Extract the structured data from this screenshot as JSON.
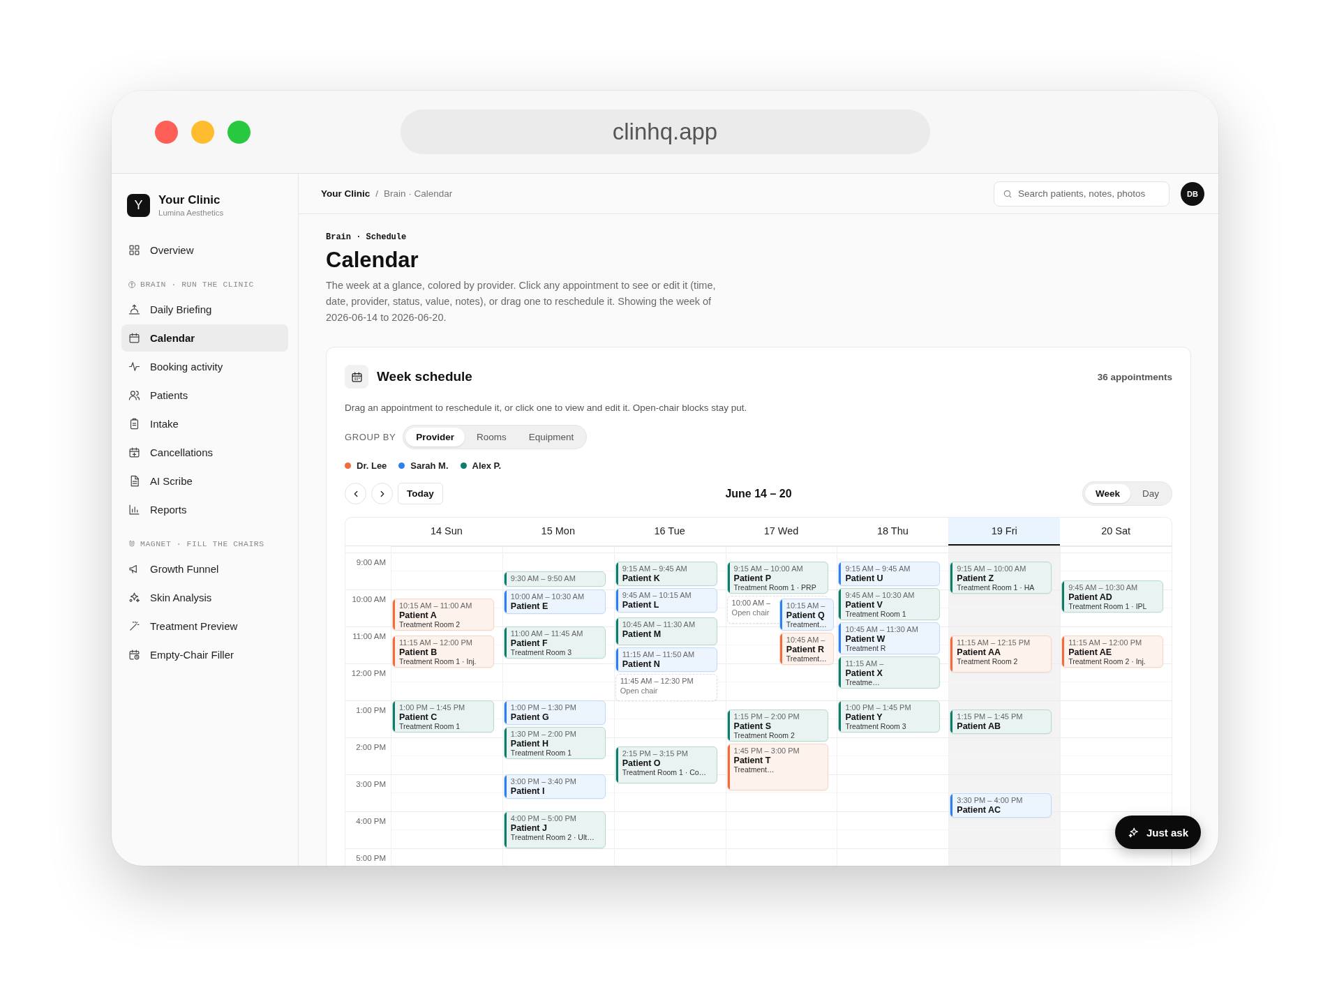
{
  "browser": {
    "url": "clinhq.app"
  },
  "sidebar": {
    "brand": {
      "logo": "Y",
      "name": "Your Clinic",
      "subtitle": "Lumina Aesthetics"
    },
    "nav": [
      {
        "kind": "item",
        "label": "Overview",
        "selected": false
      },
      {
        "kind": "section",
        "label": "BRAIN · RUN THE CLINIC"
      },
      {
        "kind": "item",
        "label": "Daily Briefing",
        "selected": false
      },
      {
        "kind": "item",
        "label": "Calendar",
        "selected": true
      },
      {
        "kind": "item",
        "label": "Booking activity",
        "selected": false
      },
      {
        "kind": "item",
        "label": "Patients",
        "selected": false
      },
      {
        "kind": "item",
        "label": "Intake",
        "selected": false
      },
      {
        "kind": "item",
        "label": "Cancellations",
        "selected": false
      },
      {
        "kind": "item",
        "label": "AI Scribe",
        "selected": false
      },
      {
        "kind": "item",
        "label": "Reports",
        "selected": false
      },
      {
        "kind": "section",
        "label": "MAGNET · FILL THE CHAIRS"
      },
      {
        "kind": "item",
        "label": "Growth Funnel",
        "selected": false
      },
      {
        "kind": "item",
        "label": "Skin Analysis",
        "selected": false
      },
      {
        "kind": "item",
        "label": "Treatment Preview",
        "selected": false
      },
      {
        "kind": "item",
        "label": "Empty-Chair Filler",
        "selected": false
      }
    ]
  },
  "topbar": {
    "breadcrumb": {
      "root": "Your Clinic",
      "separator": "/",
      "current": "Brain · Calendar"
    },
    "search": {
      "placeholder": "Search patients, notes, photos"
    },
    "avatar": "DB"
  },
  "page": {
    "eyebrow": "Brain · Schedule",
    "title": "Calendar",
    "description": "The week at a glance, colored by provider. Click any appointment to see or edit it (time, date, provider, status, value, notes), or drag one to reschedule it. Showing the week of 2026-06-14 to 2026-06-20."
  },
  "schedule": {
    "title": "Week schedule",
    "count": "36 appointments",
    "hint": "Drag an appointment to reschedule it, or click one to view and edit it. Open-chair blocks stay put.",
    "group_by": {
      "label": "GROUP BY",
      "options": [
        {
          "label": "Provider",
          "selected": true
        },
        {
          "label": "Rooms",
          "selected": false
        },
        {
          "label": "Equipment",
          "selected": false
        }
      ]
    },
    "providers": [
      {
        "name": "Dr. Lee",
        "color": "#f26b3a"
      },
      {
        "name": "Sarah M.",
        "color": "#2f80ed"
      },
      {
        "name": "Alex P.",
        "color": "#0e7c6b"
      }
    ],
    "today": "Today",
    "range": "June 14 – 20",
    "views": [
      {
        "label": "Week",
        "selected": true
      },
      {
        "label": "Day",
        "selected": false
      }
    ],
    "hours": [
      "9:00 AM",
      "10:00 AM",
      "11:00 AM",
      "12:00 PM",
      "1:00 PM",
      "2:00 PM",
      "3:00 PM",
      "4:00 PM",
      "5:00 PM"
    ],
    "days": [
      {
        "label": "14 Sun",
        "selected": false,
        "appointments": [
          {
            "kind": "booked",
            "time": "10:15 AM – 11:00 AM",
            "patient": "Patient A",
            "detail": "Treatment Room 2",
            "color": "#f26b3a"
          },
          {
            "kind": "booked",
            "time": "11:15 AM – 12:00 PM",
            "patient": "Patient B",
            "detail": "Treatment Room 1 · Inj.",
            "color": "#f26b3a"
          },
          {
            "kind": "booked",
            "time": "1:00 PM – 1:45 PM",
            "patient": "Patient C",
            "detail": "Treatment Room 1",
            "color": "#0e7c6b"
          }
        ]
      },
      {
        "label": "15 Mon",
        "selected": false,
        "appointments": [
          {
            "kind": "booked",
            "time": "9:30 AM – 9:50 AM",
            "color": "#0e7c6b"
          },
          {
            "kind": "booked",
            "time": "10:00 AM – 10:30 AM",
            "patient": "Patient E",
            "color": "#2f80ed"
          },
          {
            "kind": "booked",
            "time": "11:00 AM – 11:45 AM",
            "patient": "Patient F",
            "detail": "Treatment Room 3",
            "color": "#0e7c6b"
          },
          {
            "kind": "booked",
            "time": "1:00 PM – 1:30 PM",
            "patient": "Patient G",
            "color": "#2f80ed"
          },
          {
            "kind": "booked",
            "time": "1:30 PM – 2:00 PM",
            "patient": "Patient H",
            "detail": "Treatment Room 1",
            "color": "#0e7c6b"
          },
          {
            "kind": "booked",
            "time": "3:00 PM – 3:40 PM",
            "patient": "Patient I",
            "color": "#2f80ed"
          },
          {
            "kind": "booked",
            "time": "4:00 PM – 5:00 PM",
            "patient": "Patient J",
            "detail": "Treatment Room 2 · Ult…",
            "color": "#0e7c6b"
          }
        ]
      },
      {
        "label": "16 Tue",
        "selected": false,
        "appointments": [
          {
            "kind": "booked",
            "time": "9:15 AM – 9:45 AM",
            "patient": "Patient K",
            "color": "#0e7c6b"
          },
          {
            "kind": "booked",
            "time": "9:45 AM – 10:15 AM",
            "patient": "Patient L",
            "color": "#2f80ed"
          },
          {
            "kind": "booked",
            "time": "10:45 AM – 11:30 AM",
            "patient": "Patient M",
            "color": "#0e7c6b"
          },
          {
            "kind": "booked",
            "time": "11:15 AM – 11:50 AM",
            "patient": "Patient N",
            "color": "#2f80ed"
          },
          {
            "kind": "open",
            "time": "11:45 AM – 12:30 PM",
            "label": "Open chair"
          },
          {
            "kind": "booked",
            "time": "2:15 PM – 3:15 PM",
            "patient": "Patient O",
            "detail": "Treatment Room 1 · Co…",
            "color": "#0e7c6b"
          }
        ]
      },
      {
        "label": "17 Wed",
        "selected": false,
        "appointments": [
          {
            "kind": "booked",
            "time": "9:15 AM – 10:00 AM",
            "patient": "Patient P",
            "detail": "Treatment Room 1 · PRP",
            "color": "#0e7c6b"
          },
          {
            "kind": "open",
            "time": "10:00 AM –",
            "label": "Open chair"
          },
          {
            "kind": "booked",
            "time": "10:15 AM –",
            "patient": "Patient Q",
            "detail": "Treatment…",
            "color": "#2f80ed",
            "overlap": true
          },
          {
            "kind": "booked",
            "time": "10:45 AM –",
            "patient": "Patient R",
            "detail": "Treatment…",
            "color": "#f26b3a",
            "overlap": true
          },
          {
            "kind": "booked",
            "time": "1:15 PM – 2:00 PM",
            "patient": "Patient S",
            "detail": "Treatment Room 2",
            "color": "#0e7c6b"
          },
          {
            "kind": "booked",
            "time": "1:45 PM – 3:00 PM",
            "patient": "Patient T",
            "detail": "Treatment…",
            "color": "#f26b3a"
          }
        ]
      },
      {
        "label": "18 Thu",
        "selected": false,
        "appointments": [
          {
            "kind": "booked",
            "time": "9:15 AM – 9:45 AM",
            "patient": "Patient U",
            "color": "#2f80ed"
          },
          {
            "kind": "booked",
            "time": "9:45 AM – 10:30 AM",
            "patient": "Patient V",
            "detail": "Treatment Room 1",
            "color": "#0e7c6b"
          },
          {
            "kind": "booked",
            "time": "10:45 AM – 11:30 AM",
            "patient": "Patient W",
            "detail": "Treatment R",
            "color": "#2f80ed"
          },
          {
            "kind": "booked",
            "time": "11:15 AM –",
            "patient": "Patient X",
            "detail": "Treatme…",
            "color": "#0e7c6b"
          },
          {
            "kind": "booked",
            "time": "1:00 PM – 1:45 PM",
            "patient": "Patient Y",
            "detail": "Treatment Room 3",
            "color": "#0e7c6b"
          }
        ]
      },
      {
        "label": "19 Fri",
        "selected": true,
        "appointments": [
          {
            "kind": "booked",
            "time": "9:15 AM – 10:00 AM",
            "patient": "Patient Z",
            "detail": "Treatment Room 1 · HA",
            "color": "#0e7c6b"
          },
          {
            "kind": "booked",
            "time": "11:15 AM – 12:15 PM",
            "patient": "Patient AA",
            "detail": "Treatment Room 2",
            "color": "#f26b3a"
          },
          {
            "kind": "booked",
            "time": "1:15 PM – 1:45 PM",
            "patient": "Patient AB",
            "color": "#0e7c6b"
          },
          {
            "kind": "booked",
            "time": "3:30 PM – 4:00 PM",
            "patient": "Patient AC",
            "color": "#2f80ed"
          }
        ]
      },
      {
        "label": "20 Sat",
        "selected": false,
        "appointments": [
          {
            "kind": "booked",
            "time": "9:45 AM – 10:30 AM",
            "patient": "Patient AD",
            "detail": "Treatment Room 1 · IPL",
            "color": "#0e7c6b"
          },
          {
            "kind": "booked",
            "time": "11:15 AM – 12:00 PM",
            "patient": "Patient AE",
            "detail": "Treatment Room 2 · Inj.",
            "color": "#f26b3a"
          }
        ]
      }
    ]
  },
  "ask_button": "Just ask"
}
